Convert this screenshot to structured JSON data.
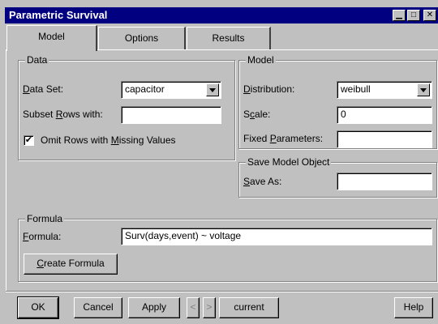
{
  "window": {
    "title": "Parametric Survival"
  },
  "tabs": [
    {
      "label": "Model"
    },
    {
      "label": "Options"
    },
    {
      "label": "Results"
    }
  ],
  "data_group": {
    "title": "Data",
    "dataset_label_u": "D",
    "dataset_label_rest": "ata Set:",
    "dataset_value": "capacitor",
    "subset_label_a": "Subset ",
    "subset_label_u": "R",
    "subset_label_b": "ows with:",
    "subset_value": "",
    "omit_label_a": "Omit Rows with ",
    "omit_label_u": "M",
    "omit_label_b": "issing Values",
    "omit_checked": "✔"
  },
  "model_group": {
    "title": "Model",
    "dist_label_u": "D",
    "dist_label_rest": "istribution:",
    "dist_value": "weibull",
    "scale_label_a": "S",
    "scale_label_u": "c",
    "scale_label_b": "ale:",
    "scale_value": "0",
    "fixed_label_a": "Fixed ",
    "fixed_label_u": "P",
    "fixed_label_b": "arameters:",
    "fixed_value": ""
  },
  "save_group": {
    "title": "Save Model Object",
    "saveas_label_u": "S",
    "saveas_label_rest": "ave As:",
    "saveas_value": ""
  },
  "formula_group": {
    "title": "Formula",
    "formula_label_u": "F",
    "formula_label_rest": "ormula:",
    "formula_value": "Surv(days,event) ~ voltage",
    "create_u": "C",
    "create_rest": "reate Formula"
  },
  "footer": {
    "ok": "OK",
    "cancel": "Cancel",
    "apply": "Apply",
    "prev": "<",
    "next": ">",
    "current": "current",
    "help": "Help"
  }
}
